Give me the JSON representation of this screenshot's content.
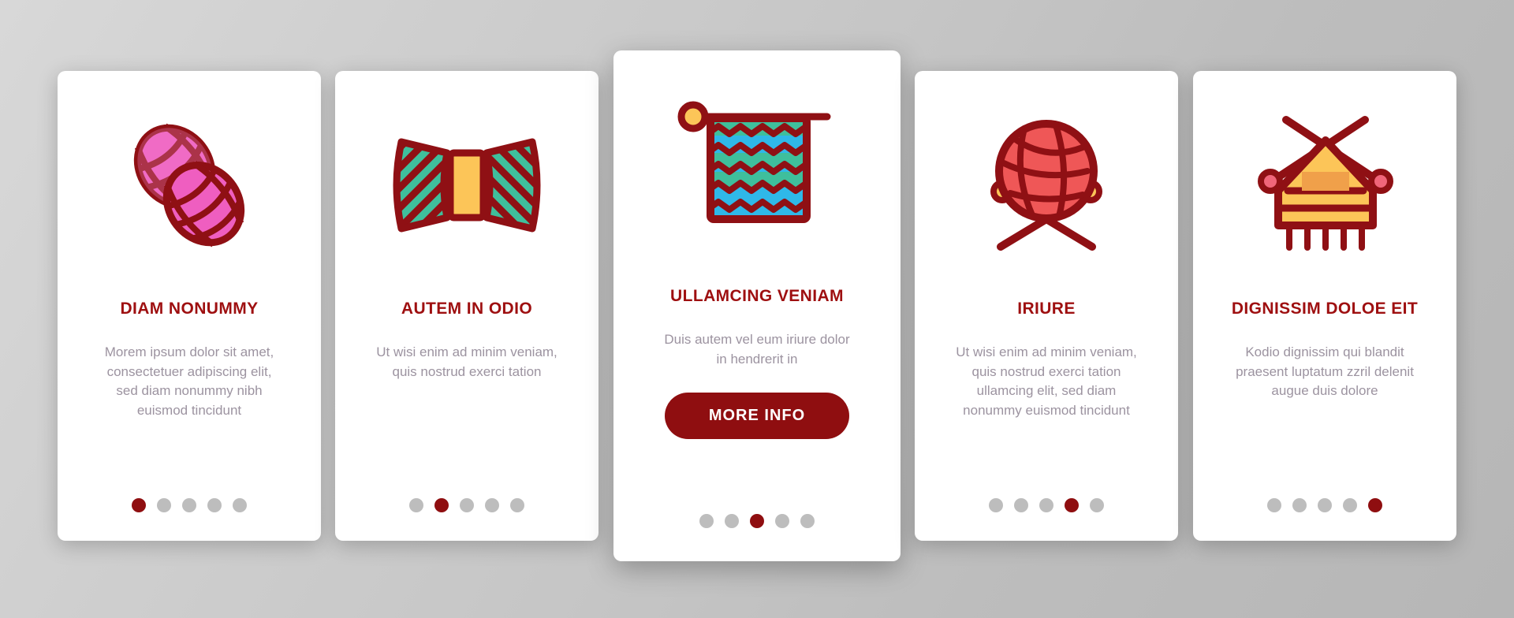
{
  "theme": {
    "accent": "#8f0e10",
    "title_color": "#9e0f10",
    "body_color": "#9c93a0",
    "card_bg": "#ffffff",
    "page_bg": "#c6c6c6",
    "dot_inactive": "#bdbdbd"
  },
  "cards": [
    {
      "id": "card-1",
      "icon": "yarn-skeins-icon",
      "title": "DIAM NONUMMY",
      "body": "Morem ipsum dolor sit amet, consectetuer adipiscing elit, sed diam nonummy nibh euismod tincidunt",
      "featured": false,
      "dots": {
        "count": 5,
        "active": 1
      }
    },
    {
      "id": "card-2",
      "icon": "yarn-spool-icon",
      "title": "AUTEM IN ODIO",
      "body": "Ut wisi enim ad minim veniam, quis nostrud exerci tation",
      "featured": false,
      "dots": {
        "count": 5,
        "active": 2
      }
    },
    {
      "id": "card-3",
      "icon": "knitted-scarf-on-needle-icon",
      "title": "ULLAMCING VENIAM",
      "body": "Duis autem vel eum iriure dolor in hendrerit in",
      "cta_label": "MORE INFO",
      "featured": true,
      "dots": {
        "count": 5,
        "active": 3
      }
    },
    {
      "id": "card-4",
      "icon": "yarn-ball-with-needles-icon",
      "title": "IRIURE",
      "body": "Ut wisi enim ad minim veniam, quis nostrud exerci tation ullamcing elit, sed diam nonummy euismod tincidunt",
      "featured": false,
      "dots": {
        "count": 5,
        "active": 4
      }
    },
    {
      "id": "card-5",
      "icon": "knitted-sweater-on-needles-icon",
      "title": "DIGNISSIM DOLOE EIT",
      "body": "Kodio dignissim qui blandit praesent luptatum zzril delenit augue duis dolore",
      "featured": false,
      "dots": {
        "count": 5,
        "active": 5
      }
    }
  ]
}
